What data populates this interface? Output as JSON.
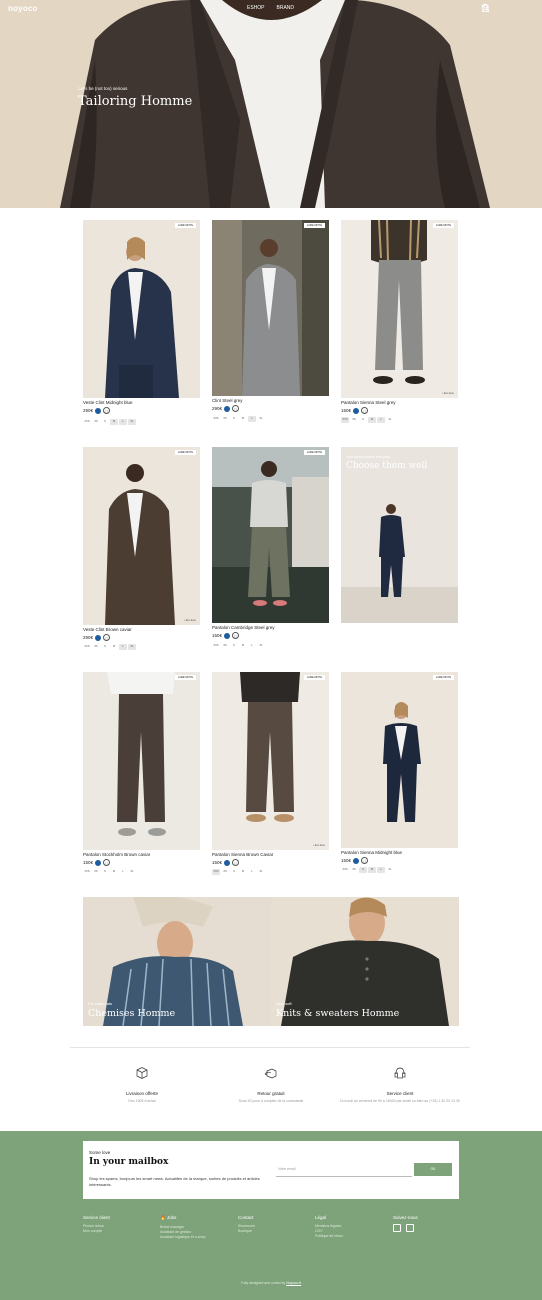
{
  "header": {
    "logo": "noyoco",
    "nav": [
      "ESHOP",
      "BRAND"
    ],
    "icons": [
      "search-icon",
      "user-icon",
      "bag-icon"
    ]
  },
  "hero": {
    "subtitle": "Let's be (not too) serious",
    "title": "Tailoring Homme"
  },
  "products": [
    {
      "badge": "LAME MIXTE",
      "name": "Veste Clint Midnight blue",
      "price": "290€",
      "sizes": [
        "XXS",
        "XS",
        "S",
        "M",
        "L",
        "XL"
      ],
      "selected": [
        3
      ]
    },
    {
      "badge": "LAME MIXTE",
      "name": "Clint Steel grey",
      "price": "290€",
      "sizes": [
        "XXS",
        "XS",
        "S",
        "M",
        "L",
        "XL"
      ],
      "selected": [
        4
      ]
    },
    {
      "badge": "LAME MIXTE",
      "name": "Pantalon Sienna Steel grey",
      "price": "150€",
      "sizes": [
        "XXS",
        "XS",
        "S",
        "M",
        "L",
        "XL"
      ],
      "selected": [
        0,
        3,
        4
      ],
      "credit": "• Eco-tissu"
    },
    {
      "badge": "LAME MIXTE",
      "name": "Veste Clint Brown caviar",
      "price": "290€",
      "sizes": [
        "XXS",
        "XS",
        "S",
        "M",
        "L",
        "XL"
      ],
      "selected": [
        4,
        5
      ],
      "credit": "• Eco-tissu"
    },
    {
      "badge": "LAME MIXTE",
      "name": "Pantalon Cambridge Steel grey",
      "price": "150€",
      "sizes": [
        "XXS",
        "XS",
        "S",
        "M",
        "L",
        "XL"
      ],
      "selected": []
    },
    {
      "badge": "LAME MIXTE",
      "name": "Pantalon Stockholm Brown caviar",
      "price": "150€",
      "sizes": [
        "XXS",
        "XS",
        "S",
        "M",
        "L",
        "XL"
      ],
      "selected": []
    },
    {
      "badge": "LAME MIXTE",
      "name": "Pantalon Sienna Brown Caviar",
      "price": "150€",
      "sizes": [
        "XXS",
        "XS",
        "S",
        "M",
        "L",
        "XL"
      ],
      "selected": [
        0
      ],
      "credit": "• Eco-tissu"
    },
    {
      "badge": "LAME MIXTE",
      "name": "Pantalon Sienna Midnight blue",
      "price": "150€",
      "sizes": [
        "XXS",
        "XS",
        "S",
        "M",
        "L",
        "XL"
      ],
      "selected": [
        2,
        3,
        4
      ]
    }
  ],
  "promo": {
    "subtitle": "Your smart clothes everyday",
    "title": "Choose them well"
  },
  "banners": [
    {
      "subtitle": "For easy cats",
      "title": "Chemises Homme"
    },
    {
      "subtitle": "Very soft",
      "title": "Knits & sweaters Homme"
    }
  ],
  "services": [
    {
      "icon": "box-icon",
      "title": "Livraison offerte",
      "desc": "Dès 150€ d'achat"
    },
    {
      "icon": "return-icon",
      "title": "Retour gratuit",
      "desc": "Sous 30 jours à compter de la commande"
    },
    {
      "icon": "headset-icon",
      "title": "Service client",
      "desc": "Du lundi au vendredi de 9h à 18h30 par email ou bien au (+33) 1 40 20 13 30"
    }
  ],
  "newsletter": {
    "small": "Some love",
    "title": "In your mailbox",
    "desc": "Shop les spams, bonjours les smart news. Actualités de la marque, sorties de produits et articles intéressants.",
    "placeholder": "Votre email",
    "button": "OK"
  },
  "footer": {
    "columns": [
      {
        "heading": "Service client",
        "links": [
          "Photos retour",
          "Mon compte"
        ]
      },
      {
        "heading": "🔥 Jobs",
        "links": [
          "Brand manager",
          "Assistant de gestion",
          "Assistant logistique et e-shop"
        ]
      },
      {
        "heading": "Contact",
        "links": [
          "Showroom",
          "Boutique"
        ]
      },
      {
        "heading": "Légal",
        "links": [
          "Mentions légales",
          "CGV",
          "Politique de retour"
        ]
      },
      {
        "heading": "Suivez-nous",
        "links": []
      }
    ],
    "social_icons": [
      "instagram-icon",
      "linkedin-icon"
    ],
    "copyright": "Fully designed and coded by",
    "copyright_link": "Noyoco.fr"
  },
  "colors": {
    "accent_green": "#7ea37a",
    "swatch_blue": "#1d5c9e",
    "hero_beige": "#e6dac8"
  }
}
